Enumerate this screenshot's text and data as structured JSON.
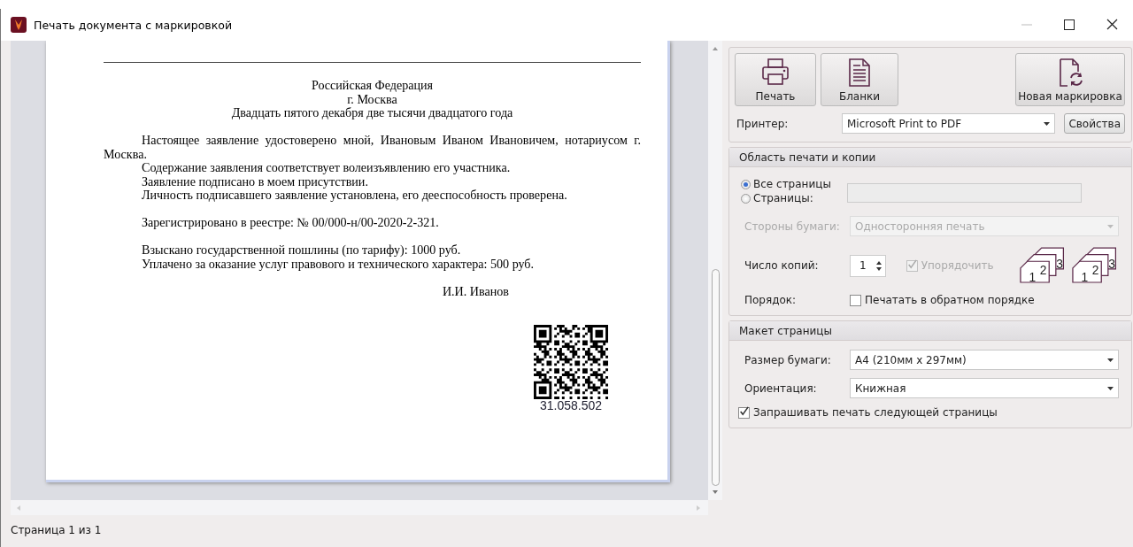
{
  "window": {
    "title": "Печать документа с маркировкой"
  },
  "preview": {
    "document": {
      "header_lines": [
        "Российская Федерация",
        "г. Москва",
        "Двадцать пятого декабря две тысячи двадцатого года"
      ],
      "blocks": [
        [
          "Настоящее заявление удостоверено мной, Ивановым Иваном Ивановичем, нотариусом г. Москва.",
          "Содержание заявления соответствует волеизъявлению его участника.",
          "Заявление подписано в моем присутствии.",
          "Личность подписавшего заявление установлена, его дееспособность проверена."
        ],
        [
          "Зарегистрировано в реестре: № 00/000-н/00-2020-2-321."
        ],
        [
          "Взыскано государственной пошлины (по тарифу): 1000 руб.",
          "Уплачено за оказание услуг правового и технического характера: 500 руб."
        ]
      ],
      "signature": "И.И. Иванов",
      "code_number": "31.058.502"
    }
  },
  "status_bar": "Страница 1 из 1",
  "toolbar": [
    {
      "label": "Печать",
      "kind": "printer"
    },
    {
      "label": "Бланки",
      "kind": "document"
    },
    {
      "label": "Новая маркировка",
      "kind": "refresh"
    }
  ],
  "printer": {
    "label": "Принтер:",
    "value": "Microsoft Print to PDF",
    "button": "Свойства"
  },
  "print_range": {
    "title": "Область печати и копии",
    "options": [
      {
        "label": "Все страницы",
        "selected": true
      },
      {
        "label": "Страницы:",
        "selected": false
      }
    ],
    "pages_field": {
      "disabled": true
    },
    "sides": {
      "label": "Стороны бумаги:",
      "value": "Односторонняя печать",
      "disabled": true
    },
    "copies": {
      "label": "Число копий:",
      "value": "1"
    },
    "collate": {
      "label": "Упорядочить",
      "checked": true,
      "disabled": true
    },
    "collate_illustrations": [
      [
        "1",
        "2",
        "3"
      ],
      [
        "1",
        "2",
        "3"
      ]
    ],
    "order": {
      "label": "Порядок:",
      "checkbox": {
        "label": "Печатать в обратном порядке",
        "checked": false
      }
    }
  },
  "page_layout": {
    "title": "Макет страницы",
    "paper_size": {
      "label": "Размер бумаги:",
      "value": "A4 (210мм x 297мм)"
    },
    "orientation": {
      "label": "Ориентация:",
      "value": "Книжная"
    },
    "ask_next": {
      "label": "Запрашивать печать следующей страницы",
      "checked": true
    }
  }
}
